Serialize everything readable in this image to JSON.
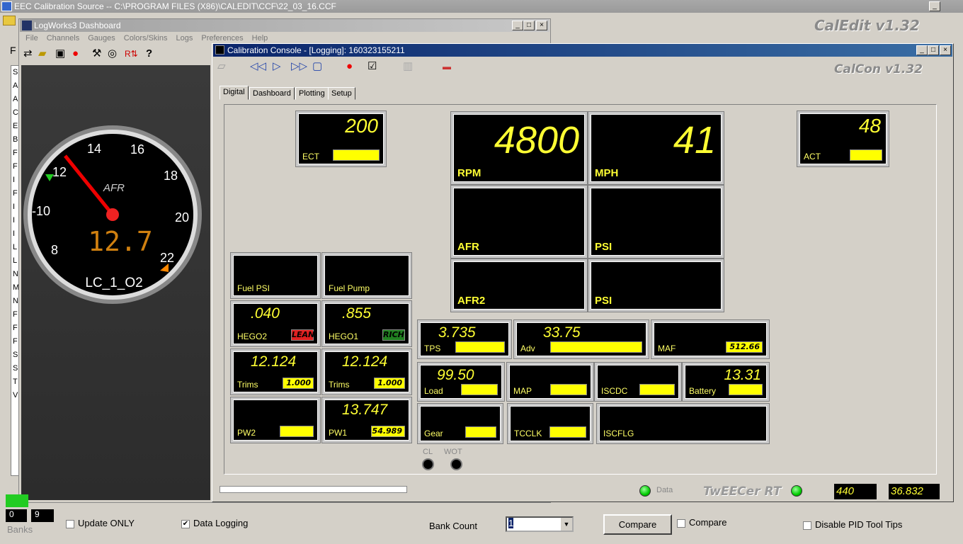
{
  "main_window": {
    "title": "EEC Calibration Source -- C:\\PROGRAM FILES (X86)\\CALEDIT\\CCF\\22_03_16.CCF",
    "logo": "CalEdit v1.32",
    "side_letters": [
      "S",
      "A",
      "A",
      "C",
      "E",
      "B",
      "F",
      "F",
      "I",
      "F",
      "I",
      "I",
      "I",
      "L",
      "L",
      "N",
      "M",
      "N",
      "F",
      "F",
      "F",
      "S",
      "S",
      "T",
      "V"
    ],
    "tab_fragment": "F"
  },
  "logworks": {
    "title": "LogWorks3 Dashboard",
    "menu": [
      "File",
      "Channels",
      "Gauges",
      "Colors/Skins",
      "Logs",
      "Preferences",
      "Help"
    ],
    "help_icon": "?",
    "gauge": {
      "label": "AFR",
      "channel": "LC_1_O2",
      "digital": "12.7",
      "ticks": [
        "8",
        "-10",
        "12",
        "14",
        "16",
        "18",
        "20",
        "22"
      ],
      "value": 12.7
    }
  },
  "console": {
    "title": "Calibration Console - [Logging]: 160323155211",
    "logo": "CalCon v1.32",
    "tabs": [
      "Digital",
      "Dashboard",
      "Plotting",
      "Setup"
    ],
    "active_tab": "Digital",
    "gauges": {
      "ect": {
        "label": "ECT",
        "value": "200",
        "bar": ""
      },
      "rpm": {
        "label": "RPM",
        "value": "4800"
      },
      "mph": {
        "label": "MPH",
        "value": "41"
      },
      "afr": {
        "label": "AFR",
        "value": ""
      },
      "psi1": {
        "label": "PSI",
        "value": ""
      },
      "afr2": {
        "label": "AFR2",
        "value": ""
      },
      "psi2": {
        "label": "PSI",
        "value": ""
      },
      "act": {
        "label": "ACT",
        "value": "48",
        "bar": ""
      },
      "fuelpsi": {
        "label": "Fuel PSI",
        "value": ""
      },
      "fuelpump": {
        "label": "Fuel Pump",
        "value": ""
      },
      "hego2": {
        "label": "HEGO2",
        "value": ".040",
        "bar": "LEAN"
      },
      "hego1": {
        "label": "HEGO1",
        "value": ".855",
        "bar": "RICH"
      },
      "trims2": {
        "label": "Trims",
        "value": "12.124",
        "bar": "1.000"
      },
      "trims1": {
        "label": "Trims",
        "value": "12.124",
        "bar": "1.000"
      },
      "pw2": {
        "label": "PW2",
        "value": "",
        "bar": ""
      },
      "pw1": {
        "label": "PW1",
        "value": "13.747",
        "bar": "54.989"
      },
      "tps": {
        "label": "TPS",
        "value": "3.735",
        "bar": ""
      },
      "adv": {
        "label": "Adv",
        "value": "33.75",
        "bar": ""
      },
      "maf": {
        "label": "MAF",
        "value": "",
        "bar": "512.66"
      },
      "load": {
        "label": "Load",
        "value": "99.50",
        "bar": ""
      },
      "map": {
        "label": "MAP",
        "value": "",
        "bar": ""
      },
      "iscdc": {
        "label": "ISCDC",
        "value": "",
        "bar": ""
      },
      "battery": {
        "label": "Battery",
        "value": "13.31",
        "bar": ""
      },
      "gear": {
        "label": "Gear",
        "value": "",
        "bar": ""
      },
      "tcclk": {
        "label": "TCCLK",
        "value": "",
        "bar": ""
      },
      "iscflg": {
        "label": "ISCFLG",
        "value": ""
      }
    },
    "indicators": {
      "cl": "CL",
      "wot": "WOT"
    },
    "status": {
      "data_label": "Data",
      "brand": "TwEECer RT",
      "readout1": "440",
      "readout2": "36.832"
    },
    "colors": {
      "lean": "#e02020",
      "rich": "#208020",
      "bar": "#ffff00",
      "value": "#ffff33"
    }
  },
  "bottom": {
    "update_only": "Update ONLY",
    "update_only_checked": false,
    "data_logging": "Data Logging",
    "data_logging_checked": true,
    "bank_count_label": "Bank Count",
    "bank_count_value": "1",
    "compare_button": "Compare",
    "compare_check": "Compare",
    "compare_checked": false,
    "disable_pid": "Disable PID Tool Tips",
    "disable_pid_checked": false,
    "banks_label": "Banks",
    "bank_cells": [
      "0",
      "9"
    ]
  }
}
